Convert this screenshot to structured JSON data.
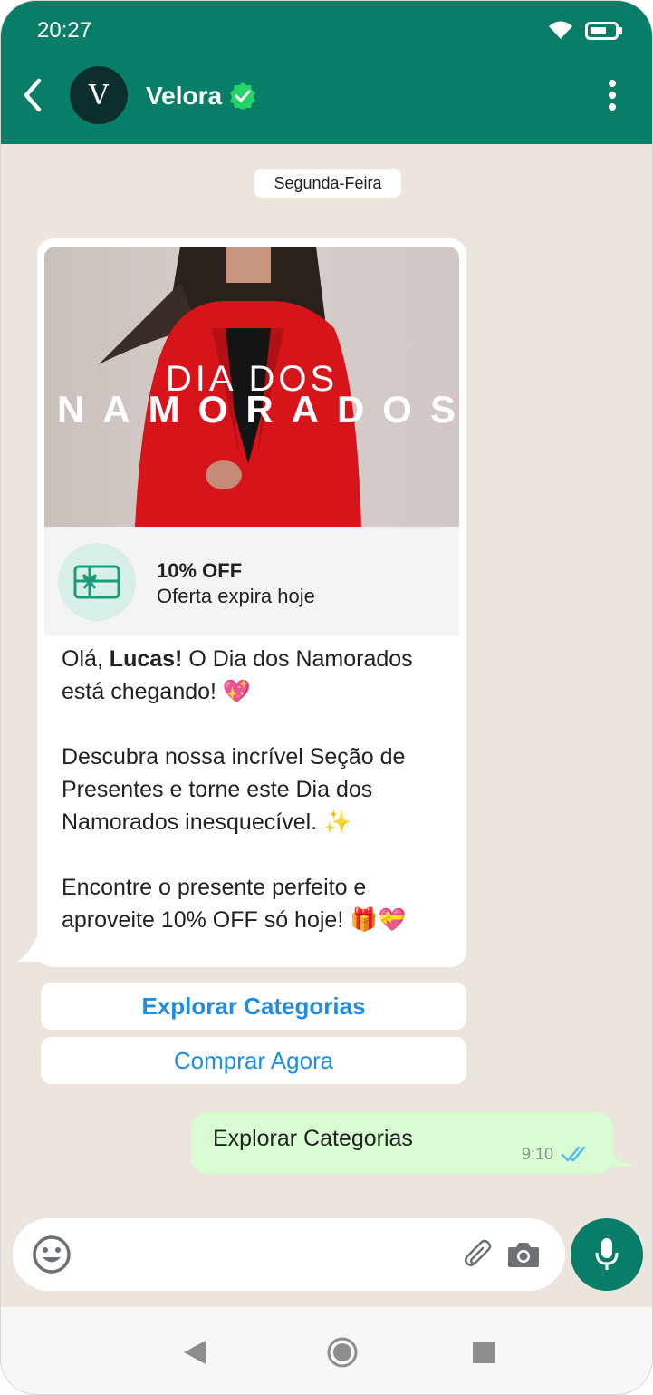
{
  "status_bar": {
    "time": "20:27"
  },
  "header": {
    "avatar_letter": "V",
    "contact_name": "Velora"
  },
  "chat": {
    "date_chip": "Segunda-Feira",
    "incoming": {
      "banner_line1": "DIA DOS",
      "banner_line2": "NAMORADOS",
      "offer_title": "10% OFF",
      "offer_subtitle": "Oferta expira hoje",
      "greeting_prefix": "Olá, ",
      "greeting_name": "Lucas!",
      "greeting_rest": " O Dia dos Namorados está chegando! 💖",
      "paragraph2": "Descubra nossa incrível Seção de Presentes e torne este Dia dos Namorados inesquecível. ✨",
      "paragraph3": "Encontre o presente perfeito e aproveite 10% OFF só hoje! 🎁💝"
    },
    "reply_buttons": [
      "Explorar Categorias",
      "Comprar Agora"
    ],
    "outgoing": {
      "text": "Explorar Categorias",
      "time": "9:10"
    }
  },
  "colors": {
    "header_green": "#087e68",
    "chat_background": "#ece5dd",
    "outgoing_bubble": "#d9fdd3",
    "link_blue": "#1f8ee0",
    "verified_green": "#25d366",
    "read_tick_blue": "#53bdeb"
  },
  "icons": [
    "back-icon",
    "verified-icon",
    "menu-icon",
    "wifi-icon",
    "battery-icon",
    "gift-card-icon",
    "double-tick-icon",
    "emoji-icon",
    "attach-icon",
    "camera-icon",
    "mic-icon",
    "nav-back-icon",
    "nav-home-icon",
    "nav-recent-icon"
  ]
}
